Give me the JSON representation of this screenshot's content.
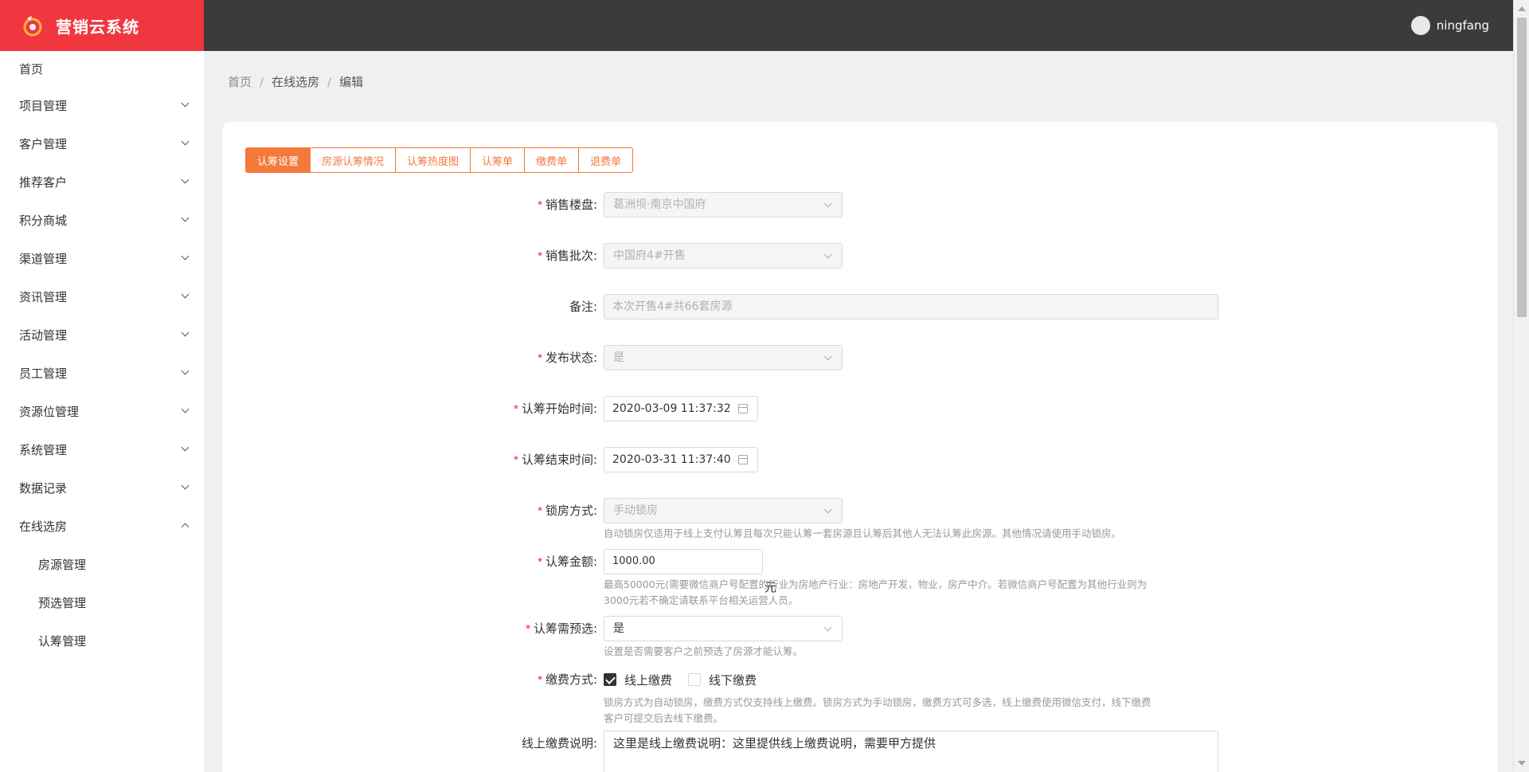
{
  "header": {
    "app_title": "营销云系统",
    "username": "ningfang",
    "brand_color": "#f0373f",
    "topbar_color": "#3b3b3b"
  },
  "sidebar": {
    "items": [
      {
        "label": "首页"
      },
      {
        "label": "项目管理"
      },
      {
        "label": "客户管理"
      },
      {
        "label": "推荐客户"
      },
      {
        "label": "积分商城"
      },
      {
        "label": "渠道管理"
      },
      {
        "label": "资讯管理"
      },
      {
        "label": "活动管理"
      },
      {
        "label": "员工管理"
      },
      {
        "label": "资源位管理"
      },
      {
        "label": "系统管理"
      },
      {
        "label": "数据记录"
      },
      {
        "label": "在线选房"
      }
    ],
    "subitems": [
      {
        "label": "房源管理"
      },
      {
        "label": "预选管理"
      },
      {
        "label": "认筹管理"
      }
    ]
  },
  "breadcrumb": [
    "首页",
    "在线选房",
    "编辑"
  ],
  "tabs": [
    {
      "label": "认筹设置",
      "active": true
    },
    {
      "label": "房源认筹情况"
    },
    {
      "label": "认筹热度图"
    },
    {
      "label": "认筹单"
    },
    {
      "label": "缴费单"
    },
    {
      "label": "退费单"
    }
  ],
  "accent_color": "#f47a3c",
  "form": {
    "property": {
      "label": "销售楼盘:",
      "value": "葛洲坝·南京中国府"
    },
    "batch": {
      "label": "销售批次:",
      "value": "中国府4#开售"
    },
    "remark": {
      "label": "备注:",
      "value": "本次开售4#共66套房源"
    },
    "publish": {
      "label": "发布状态:",
      "value": "是"
    },
    "start_time": {
      "label": "认筹开始时间:",
      "value": "2020-03-09 11:37:32"
    },
    "end_time": {
      "label": "认筹结束时间:",
      "value": "2020-03-31 11:37:40"
    },
    "lock": {
      "label": "锁房方式:",
      "value": "手动锁房",
      "hint": "自动锁房仅适用于线上支付认筹且每次只能认筹一套房源且认筹后其他人无法认筹此房源。其他情况请使用手动锁房。"
    },
    "amount": {
      "label": "认筹金额:",
      "value": "1000.00",
      "unit": "元",
      "hint_line1": "最高50000元(需要微信商户号配置的行业为房地产行业：房地产开发，物业，房产中介。若微信商户号配置为其他行业则为",
      "hint_line2": "3000元若不确定请联系平台相关运营人员。"
    },
    "preselect": {
      "label": "认筹需预选:",
      "value": "是",
      "hint": "设置是否需要客户之前预选了房源才能认筹。"
    },
    "payment": {
      "label": "缴费方式:",
      "online": "线上缴费",
      "offline": "线下缴费",
      "hint_line1": "锁房方式为自动锁房，缴费方式仅支持线上缴费。锁房方式为手动锁房，缴费方式可多选，线上缴费使用微信支付，线下缴费",
      "hint_line2": "客户可提交后去线下缴费。"
    },
    "online_note": {
      "label": "线上缴费说明:",
      "value": "这里是线上缴费说明：这里提供线上缴费说明，需要甲方提供"
    }
  }
}
